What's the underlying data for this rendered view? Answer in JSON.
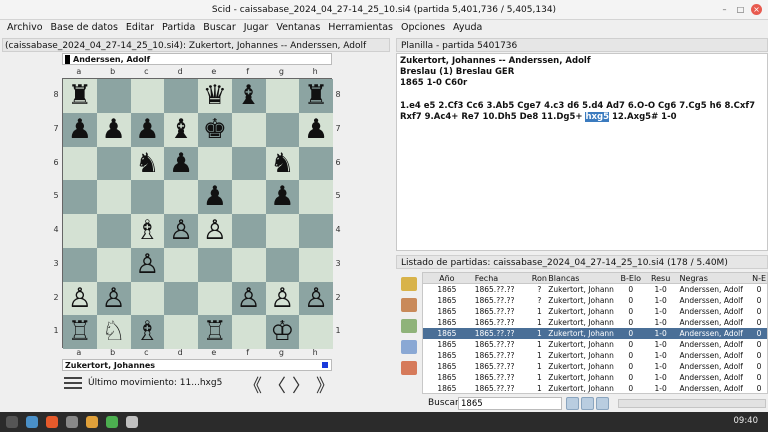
{
  "window": {
    "title": "Scid - caissabase_2024_04_27-14_25_10.si4 (partida 5,401,736 / 5,405,134)"
  },
  "menu": [
    "Archivo",
    "Base de datos",
    "Editar",
    "Partida",
    "Buscar",
    "Jugar",
    "Ventanas",
    "Herramientas",
    "Opciones",
    "Ayuda"
  ],
  "board_panel": {
    "title": "(caissabase_2024_04_27-14_25_10.si4): Zukertort, Johannes -- Anderssen, Adolf",
    "top_player": "Anderssen, Adolf",
    "bottom_player": "Zukertort, Johannes",
    "files": [
      "a",
      "b",
      "c",
      "d",
      "e",
      "f",
      "g",
      "h"
    ],
    "ranks": [
      "8",
      "7",
      "6",
      "5",
      "4",
      "3",
      "2",
      "1"
    ],
    "position": [
      [
        "♜",
        "",
        "",
        "",
        "♛",
        "♝",
        "",
        "♜"
      ],
      [
        "♟",
        "♟",
        "♟",
        "♝",
        "♚",
        "",
        "",
        "♟"
      ],
      [
        "",
        "",
        "♞",
        "♟",
        "",
        "",
        "♞",
        ""
      ],
      [
        "",
        "",
        "",
        "",
        "♟",
        "",
        "♟",
        ""
      ],
      [
        "",
        "",
        "♗",
        "♙",
        "♙",
        "",
        "",
        ""
      ],
      [
        "",
        "",
        "♙",
        "",
        "",
        "",
        "",
        ""
      ],
      [
        "♙",
        "♙",
        "",
        "",
        "",
        "♙",
        "♙",
        "♙"
      ],
      [
        "♖",
        "♘",
        "♗",
        "",
        "♖",
        "",
        "♔",
        ""
      ]
    ],
    "last_move_label": "Último movimiento: 11...hxg5",
    "nav": [
      "《",
      "〈",
      "〉",
      "》"
    ]
  },
  "notation": {
    "title": "Planilla - partida 5401736",
    "header_line1": "Zukertort, Johannes  --  Anderssen, Adolf",
    "header_line2": "Breslau (1)  Breslau GER",
    "header_line3": "1865  1-0  C60r",
    "moves_before": "1.e4 e5 2.Cf3 Cc6 3.Ab5 Cge7 4.c3 d6 5.d4 Ad7 6.O-O Cg6 7.Cg5 h6 8.Cxf7 Rxf7 9.Ac4+ Re7 10.Dh5 De8 11.Dg5+ ",
    "current_move": "hxg5",
    "moves_after": " 12.Axg5# 1-0"
  },
  "game_list": {
    "title": "Listado de partidas: caissabase_2024_04_27-14_25_10.si4 (178 / 5.40M)",
    "columns": [
      "Año",
      "Fecha",
      "Ron",
      "Blancas",
      "B-Elo",
      "Resu",
      "Negras",
      "N-E"
    ],
    "rows": [
      [
        "1865",
        "1865.??.??",
        "?",
        "Zukertort, Johann",
        "0",
        "1-0",
        "Anderssen, Adolf",
        "0"
      ],
      [
        "1865",
        "1865.??.??",
        "?",
        "Zukertort, Johann",
        "0",
        "1-0",
        "Anderssen, Adolf",
        "0"
      ],
      [
        "1865",
        "1865.??.??",
        "1",
        "Zukertort, Johann",
        "0",
        "1-0",
        "Anderssen, Adolf",
        "0"
      ],
      [
        "1865",
        "1865.??.??",
        "1",
        "Zukertort, Johann",
        "0",
        "1-0",
        "Anderssen, Adolf",
        "0"
      ],
      [
        "1865",
        "1865.??.??",
        "1",
        "Zukertort, Johann",
        "0",
        "1-0",
        "Anderssen, Adolf",
        "0"
      ],
      [
        "1865",
        "1865.??.??",
        "1",
        "Zukertort, Johann",
        "0",
        "1-0",
        "Anderssen, Adolf",
        "0"
      ],
      [
        "1865",
        "1865.??.??",
        "1",
        "Zukertort, Johann",
        "0",
        "1-0",
        "Anderssen, Adolf",
        "0"
      ],
      [
        "1865",
        "1865.??.??",
        "1",
        "Zukertort, Johann",
        "0",
        "1-0",
        "Anderssen, Adolf",
        "0"
      ],
      [
        "1865",
        "1865.??.??",
        "1",
        "Zukertort, Johann",
        "0",
        "1-0",
        "Anderssen, Adolf",
        "0"
      ],
      [
        "1865",
        "1865.??.??",
        "1",
        "Zukertort, Johann",
        "0",
        "1-0",
        "Anderssen, Adolf",
        "0"
      ]
    ],
    "selected_row": 4,
    "search_label": "Buscar",
    "search_value": "1865"
  },
  "taskbar": {
    "clock": "09:40"
  },
  "colors": {
    "light_square": "#d4e1d3",
    "dark_square": "#8ca4a2",
    "selection": "#4a6f97"
  }
}
